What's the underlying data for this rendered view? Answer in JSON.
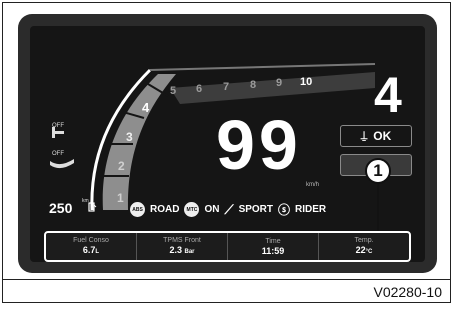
{
  "dashboard": {
    "gear": "4",
    "speed": "99",
    "speed_unit": "km/h",
    "rpm_scale": [
      "1",
      "2",
      "3",
      "4",
      "5",
      "6",
      "7",
      "8",
      "9",
      "10"
    ],
    "rpm_active_level": 4,
    "left_indicators": {
      "top_label": "OFF",
      "bottom_label": "OFF"
    },
    "fuel_range": "250",
    "fuel_range_unit": "km",
    "buttons": {
      "ok_label": "OK",
      "start_label": "S"
    },
    "status": {
      "abs_chip": "ABS",
      "abs_mode": "ROAD",
      "mtc_chip": "MTC",
      "mtc_mode": "ON",
      "ride_mode": "SPORT",
      "rider_mode": "RIDER"
    },
    "info_bar": [
      {
        "label": "Fuel Conso",
        "value": "6.7",
        "unit": "L"
      },
      {
        "label": "TPMS Front",
        "value": "2.3",
        "unit": "Bar"
      },
      {
        "label": "Time",
        "value": "11:59",
        "unit": ""
      },
      {
        "label": "Temp.",
        "value": "22",
        "unit": "°C"
      }
    ],
    "callout_number": "1",
    "figure_code": "V02280-10"
  },
  "colors": {
    "screen": "#151515",
    "text": "#ffffff",
    "arc_active": "#8a8a8a",
    "arc_inactive": "#4a4a4a"
  }
}
